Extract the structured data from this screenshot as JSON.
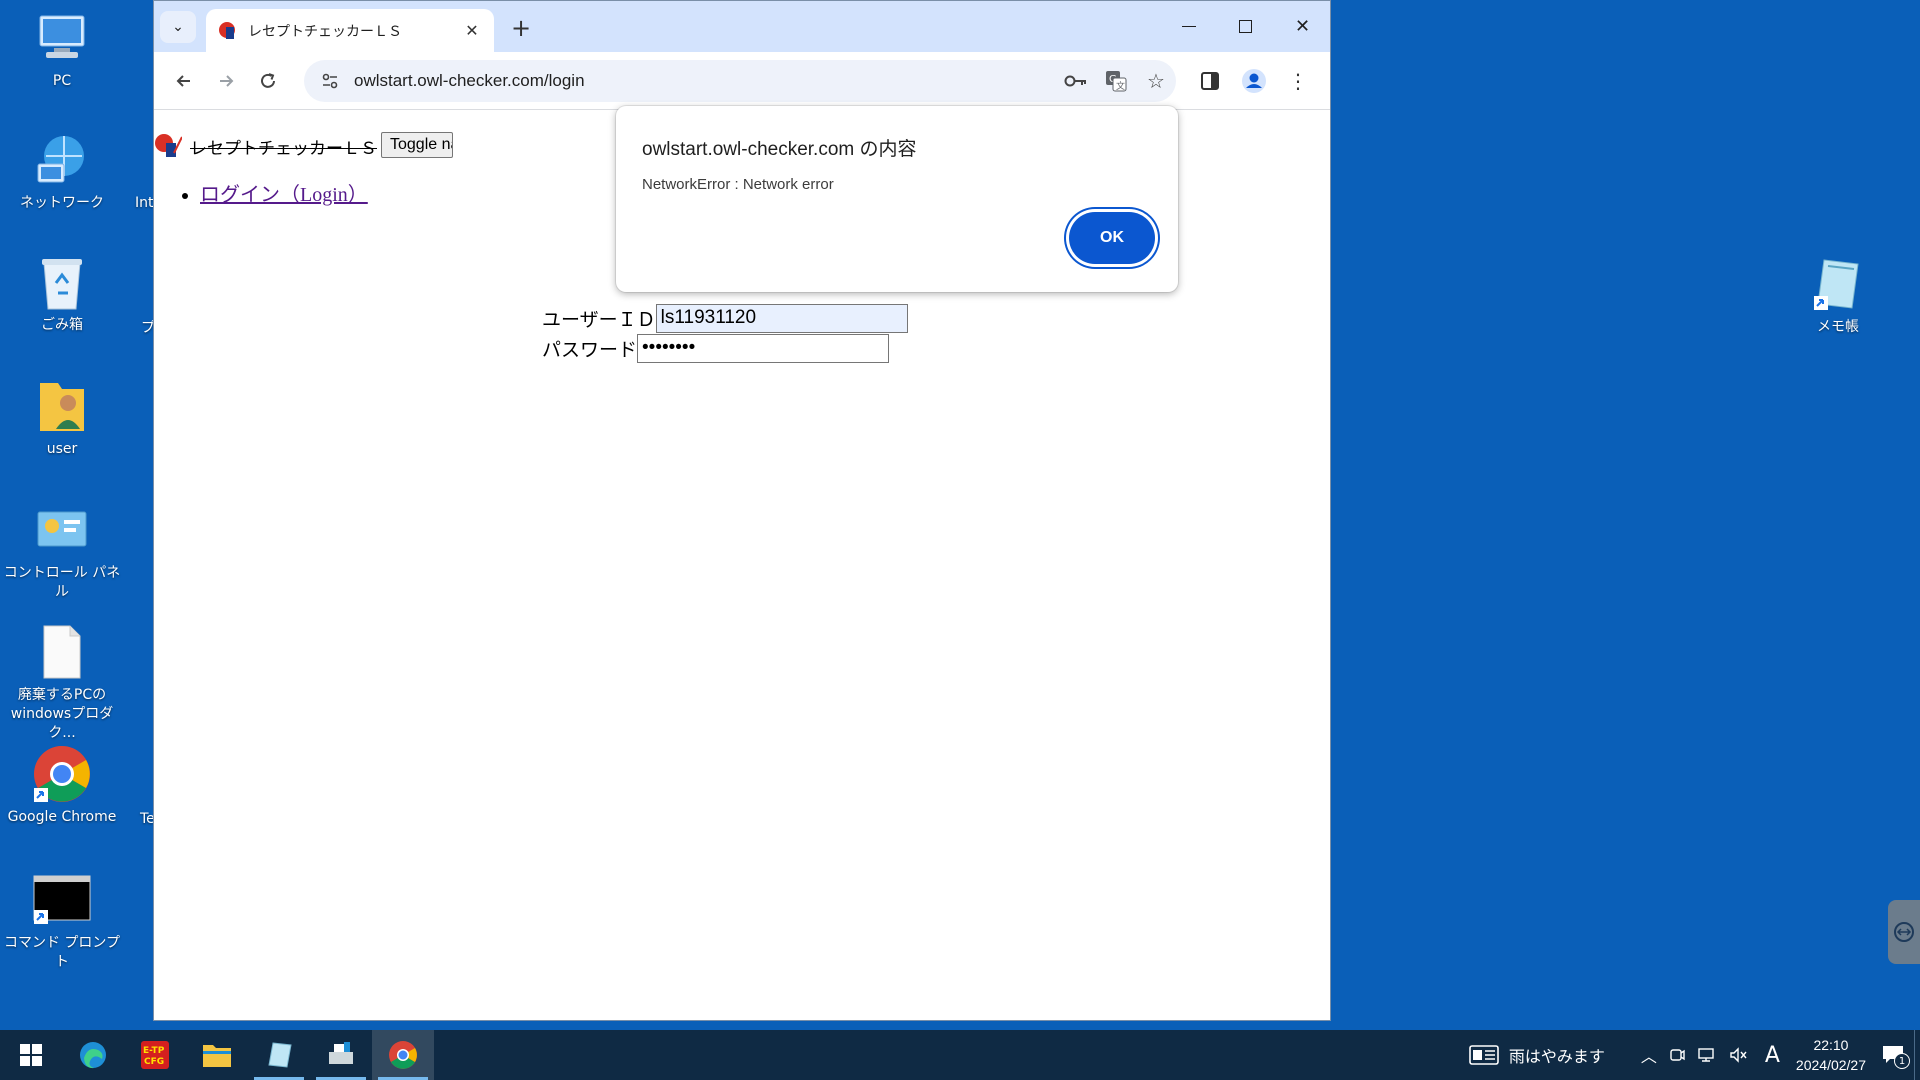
{
  "desktop": {
    "icons": [
      {
        "label": "PC"
      },
      {
        "label": "ネットワーク"
      },
      {
        "label": "ごみ箱"
      },
      {
        "label": "user"
      },
      {
        "label": "コントロール パネル"
      },
      {
        "label": "廃棄するPCのwindowsプロダク..."
      },
      {
        "label": "Google Chrome"
      },
      {
        "label": "コマンド プロンプト"
      },
      {
        "label": "メモ帳"
      }
    ],
    "partial_labels": [
      "Int",
      "プ",
      "Te"
    ]
  },
  "browser": {
    "tab_title": "レセプトチェッカーＬＳ",
    "tab_close": "✕",
    "new_tab": "+",
    "url": "owlstart.owl-checker.com/login",
    "window_controls": {
      "minimize": "—",
      "maximize": "☐",
      "close": "✕"
    }
  },
  "page": {
    "header_text": "レセプトチェッカーＬＳ",
    "toggle_label": "Toggle navigation",
    "menu": [
      {
        "label": "ログイン（Login）"
      }
    ],
    "form": {
      "user_label": "ユーザーＩＤ",
      "user_value": "ls11931120",
      "password_label": "パスワード",
      "password_value": "••••••••"
    }
  },
  "dialog": {
    "title": "owlstart.owl-checker.com の内容",
    "message": "NetworkError : Network error",
    "ok_label": "OK"
  },
  "taskbar": {
    "weather": "雨はやみます",
    "ime": "A",
    "time": "22:10",
    "date": "2024/02/27",
    "notification_count": "1"
  },
  "colors": {
    "desktop": "#0a5fb8",
    "accent": "#0b57d0",
    "link_visited": "#551a8b"
  }
}
